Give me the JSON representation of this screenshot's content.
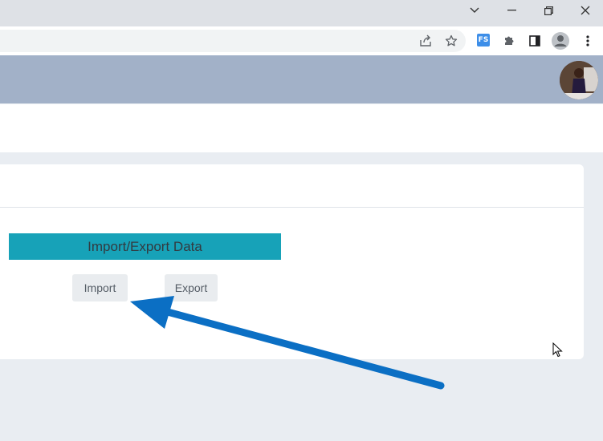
{
  "browser": {
    "window_controls": [
      "chevron-down-icon",
      "minimize-icon",
      "restore-icon",
      "close-icon"
    ],
    "extension_label": "FS"
  },
  "card": {
    "banner_title": "Import/Export Data",
    "import_label": "Import",
    "export_label": "Export"
  },
  "colors": {
    "header": "#a2b1c8",
    "banner": "#17a2b8",
    "arrow": "#0b6fc4"
  }
}
